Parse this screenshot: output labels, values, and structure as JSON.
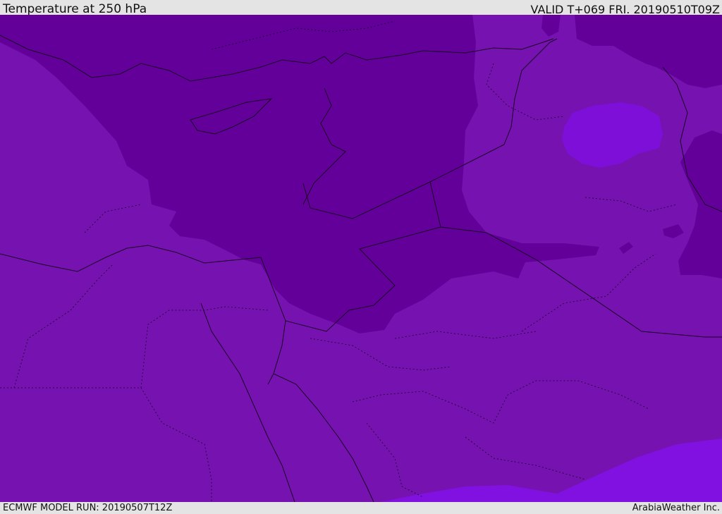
{
  "header": {
    "title": "Temperature at 250 hPa",
    "valid_time": "VALID T+069 FRI. 20190510T09Z"
  },
  "footer": {
    "model_run": "ECMWF MODEL RUN: 20190507T12Z",
    "credit": "ArabiaWeather Inc."
  },
  "colors": {
    "base_field": "#7612b0",
    "cold_core": "#63009a",
    "warm_patch": "#7e0fd8",
    "light_patch": "#8111e0",
    "borders": "#1a0026"
  }
}
